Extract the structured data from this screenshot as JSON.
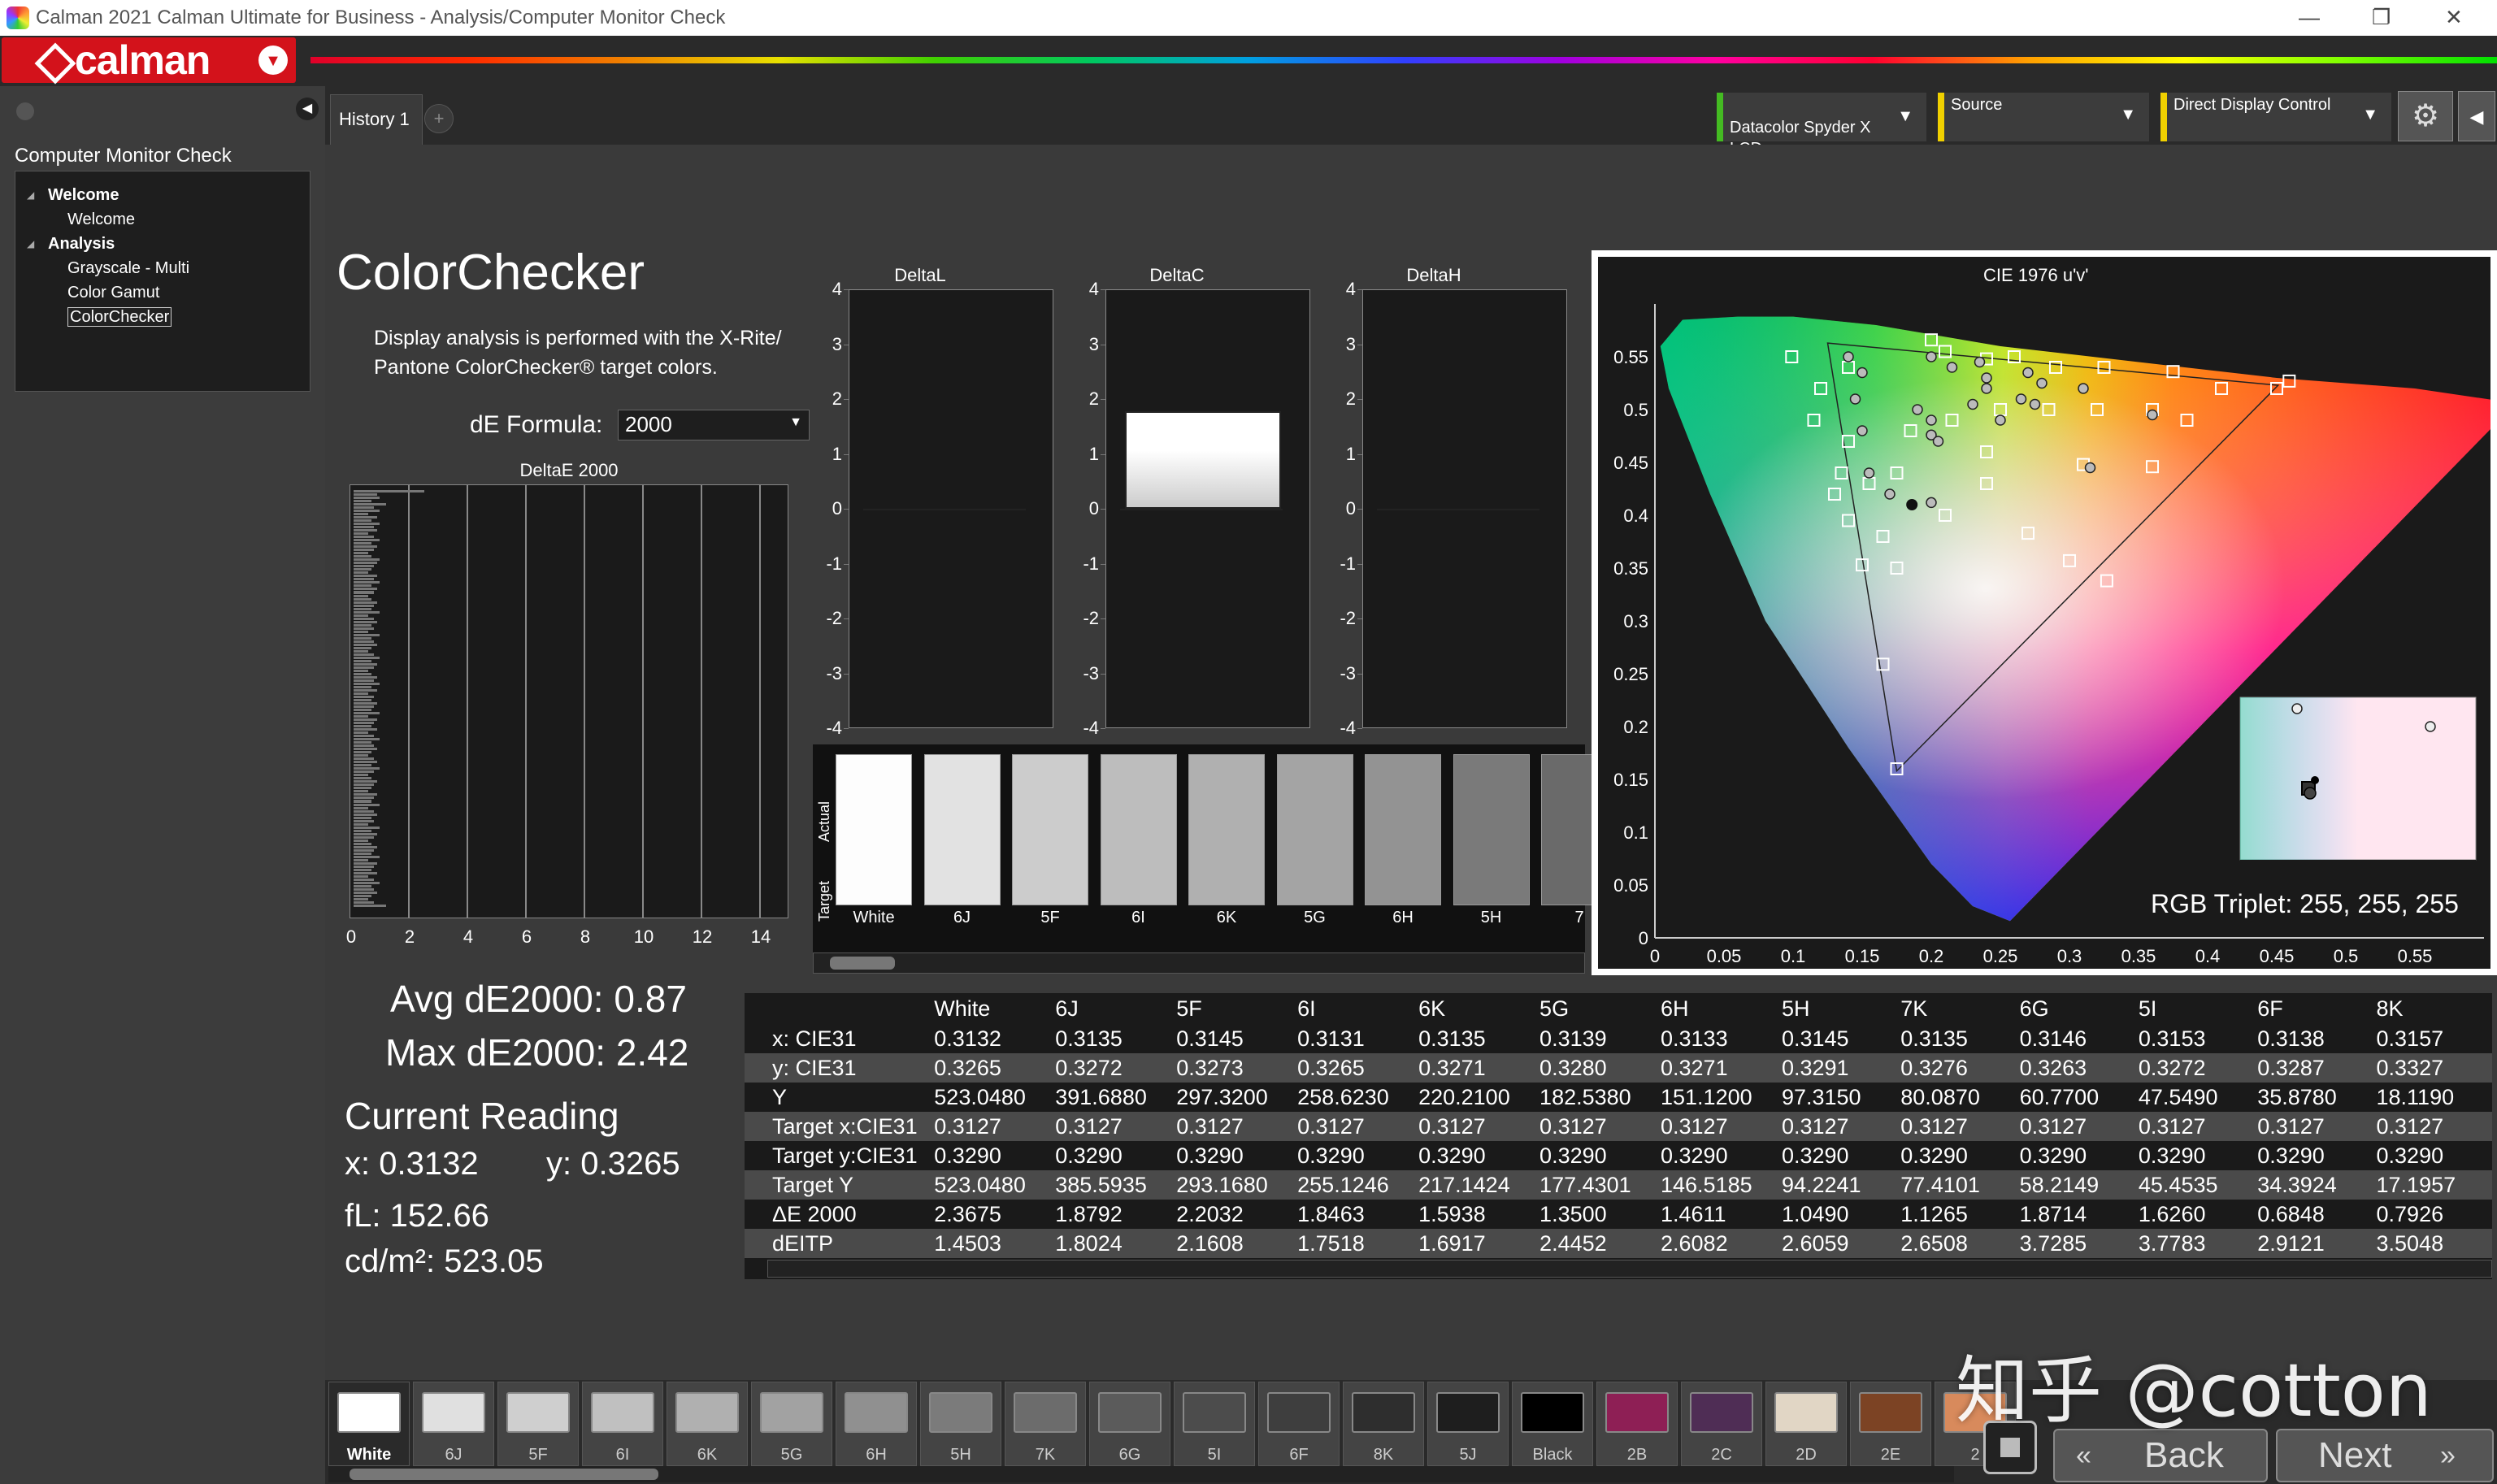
{
  "window": {
    "title": "Calman 2021 Calman Ultimate for Business  - Analysis/Computer Monitor Check"
  },
  "logo": {
    "text": "calman"
  },
  "sidebar": {
    "workflow_title": "Computer Monitor Check",
    "tree": [
      {
        "label": "Welcome",
        "level": 1
      },
      {
        "label": "Welcome",
        "level": 2
      },
      {
        "label": "Analysis",
        "level": 1
      },
      {
        "label": "Grayscale - Multi",
        "level": 2
      },
      {
        "label": "Color Gamut",
        "level": 2
      },
      {
        "label": "ColorChecker",
        "level": 2,
        "selected": true
      }
    ]
  },
  "tabs": {
    "history_label": "History 1",
    "add_label": "+"
  },
  "devices": {
    "meter": "Datacolor Spyder X\nLCD",
    "source": "Source",
    "display": "Direct Display Control",
    "meter_color": "#44bb22",
    "source_color": "#f0d000",
    "display_color": "#f0d000"
  },
  "page": {
    "title": "ColorChecker",
    "description": "Display analysis is performed with the X-Rite/ Pantone ColorChecker® target colors.",
    "de_formula_label": "dE Formula:",
    "de_formula_value": "2000"
  },
  "histogram": {
    "title": "DeltaE 2000",
    "x_ticks": [
      "0",
      "2",
      "4",
      "6",
      "8",
      "10",
      "12",
      "14"
    ],
    "bars": [
      2.42,
      0.8,
      0.9,
      0.6,
      1.1,
      0.7,
      0.9,
      0.5,
      0.8,
      0.6,
      0.9,
      0.7,
      0.8,
      0.5,
      0.7,
      0.9,
      0.6,
      0.8,
      0.7,
      0.5,
      0.6,
      0.9,
      0.8,
      0.7,
      0.6,
      0.5,
      0.8,
      0.7,
      0.9,
      0.6,
      0.8,
      0.7,
      0.5,
      0.6,
      0.8,
      0.7,
      0.6,
      0.9,
      0.5,
      0.7,
      0.8,
      0.6,
      0.7,
      0.5,
      0.9,
      0.6,
      0.7,
      0.8,
      0.6,
      0.5,
      0.7,
      0.9,
      0.6,
      0.8,
      0.7,
      0.5,
      0.6,
      0.8,
      0.7,
      0.9,
      0.6,
      0.8,
      0.5,
      0.7,
      0.6,
      0.8,
      0.7,
      0.6,
      0.9,
      0.5,
      0.8,
      0.7,
      0.6,
      0.8,
      0.5,
      0.7,
      0.9,
      0.6,
      0.7,
      0.8,
      0.6,
      0.5,
      0.7,
      0.8,
      0.6,
      0.9,
      0.7,
      0.5,
      0.6,
      0.8,
      0.7,
      0.6,
      0.5,
      0.8,
      0.7,
      0.6,
      0.9,
      0.5,
      0.7,
      0.8,
      0.6,
      0.7,
      0.5,
      0.9,
      0.6,
      0.8,
      0.7,
      0.5,
      0.6,
      0.8,
      0.7,
      0.6,
      0.9,
      0.5,
      0.8,
      0.7,
      0.6,
      0.8,
      0.5,
      0.7,
      0.9,
      0.6,
      0.7,
      0.8,
      0.6,
      0.5,
      0.7,
      1.1
    ]
  },
  "delta_panels": [
    {
      "title": "DeltaL",
      "value": 0.0
    },
    {
      "title": "DeltaC",
      "value": 1.78
    },
    {
      "title": "DeltaH",
      "value": 0.0
    }
  ],
  "delta_ticks": [
    "4",
    "3",
    "2",
    "1",
    "0",
    "-1",
    "-2",
    "-3",
    "-4"
  ],
  "patch_strip": {
    "actual_label": "Actual",
    "target_label": "Target",
    "patches": [
      {
        "label": "White",
        "color": "#fdfdfd"
      },
      {
        "label": "6J",
        "color": "#e2e2e2"
      },
      {
        "label": "5F",
        "color": "#cccccc"
      },
      {
        "label": "6I",
        "color": "#bdbdbd"
      },
      {
        "label": "6K",
        "color": "#b0b0b0"
      },
      {
        "label": "5G",
        "color": "#a4a4a4"
      },
      {
        "label": "6H",
        "color": "#939393"
      },
      {
        "label": "5H",
        "color": "#7a7a7a"
      },
      {
        "label": "7",
        "color": "#6a6a6a"
      }
    ]
  },
  "cie": {
    "title": "CIE 1976 u'v'",
    "rgb_triplet": "RGB Triplet: 255, 255, 255",
    "x_ticks": [
      "0",
      "0.05",
      "0.1",
      "0.15",
      "0.2",
      "0.25",
      "0.3",
      "0.35",
      "0.4",
      "0.45",
      "0.5",
      "0.55"
    ],
    "y_ticks": [
      "0",
      "0.05",
      "0.1",
      "0.15",
      "0.2",
      "0.25",
      "0.3",
      "0.35",
      "0.4",
      "0.45",
      "0.5",
      "0.55"
    ]
  },
  "stats": {
    "avg": "Avg dE2000: 0.87",
    "max": "Max dE2000: 2.42",
    "current_reading": "Current Reading",
    "x": "x: 0.3132",
    "y": "y: 0.3265",
    "fl": "fL: 152.66",
    "cdm2": "cd/m²: 523.05"
  },
  "table": {
    "columns": [
      "White",
      "6J",
      "5F",
      "6I",
      "6K",
      "5G",
      "6H",
      "5H",
      "7K",
      "6G",
      "5I",
      "6F",
      "8K"
    ],
    "rows": [
      {
        "label": "x: CIE31",
        "values": [
          "0.3132",
          "0.3135",
          "0.3145",
          "0.3131",
          "0.3135",
          "0.3139",
          "0.3133",
          "0.3145",
          "0.3135",
          "0.3146",
          "0.3153",
          "0.3138",
          "0.3157"
        ]
      },
      {
        "label": "y: CIE31",
        "values": [
          "0.3265",
          "0.3272",
          "0.3273",
          "0.3265",
          "0.3271",
          "0.3280",
          "0.3271",
          "0.3291",
          "0.3276",
          "0.3263",
          "0.3272",
          "0.3287",
          "0.3327"
        ]
      },
      {
        "label": "Y",
        "values": [
          "523.0480",
          "391.6880",
          "297.3200",
          "258.6230",
          "220.2100",
          "182.5380",
          "151.1200",
          "97.3150",
          "80.0870",
          "60.7700",
          "47.5490",
          "35.8780",
          "18.1190"
        ]
      },
      {
        "label": "Target x:CIE31",
        "values": [
          "0.3127",
          "0.3127",
          "0.3127",
          "0.3127",
          "0.3127",
          "0.3127",
          "0.3127",
          "0.3127",
          "0.3127",
          "0.3127",
          "0.3127",
          "0.3127",
          "0.3127"
        ]
      },
      {
        "label": "Target y:CIE31",
        "values": [
          "0.3290",
          "0.3290",
          "0.3290",
          "0.3290",
          "0.3290",
          "0.3290",
          "0.3290",
          "0.3290",
          "0.3290",
          "0.3290",
          "0.3290",
          "0.3290",
          "0.3290"
        ]
      },
      {
        "label": "Target Y",
        "values": [
          "523.0480",
          "385.5935",
          "293.1680",
          "255.1246",
          "217.1424",
          "177.4301",
          "146.5185",
          "94.2241",
          "77.4101",
          "58.2149",
          "45.4535",
          "34.3924",
          "17.1957"
        ]
      },
      {
        "label": "ΔE 2000",
        "values": [
          "2.3675",
          "1.8792",
          "2.2032",
          "1.8463",
          "1.5938",
          "1.3500",
          "1.4611",
          "1.0490",
          "1.1265",
          "1.8714",
          "1.6260",
          "0.6848",
          "0.7926"
        ]
      },
      {
        "label": "dEITP",
        "values": [
          "1.4503",
          "1.8024",
          "2.1608",
          "1.7518",
          "1.6917",
          "2.4452",
          "2.6082",
          "2.6059",
          "2.6508",
          "3.7285",
          "3.7783",
          "2.9121",
          "3.5048"
        ]
      }
    ]
  },
  "bottom_strip": [
    {
      "label": "White",
      "color": "#ffffff"
    },
    {
      "label": "6J",
      "color": "#e0e0e0"
    },
    {
      "label": "5F",
      "color": "#cfcfcf"
    },
    {
      "label": "6I",
      "color": "#c0c0c0"
    },
    {
      "label": "6K",
      "color": "#b0b0b0"
    },
    {
      "label": "5G",
      "color": "#a2a2a2"
    },
    {
      "label": "6H",
      "color": "#909090"
    },
    {
      "label": "5H",
      "color": "#7b7b7b"
    },
    {
      "label": "7K",
      "color": "#6c6c6c"
    },
    {
      "label": "6G",
      "color": "#5b5b5b"
    },
    {
      "label": "5I",
      "color": "#4c4c4c"
    },
    {
      "label": "6F",
      "color": "#3e3e3e"
    },
    {
      "label": "8K",
      "color": "#2e2e2e"
    },
    {
      "label": "5J",
      "color": "#1e1e1e"
    },
    {
      "label": "Black",
      "color": "#000000"
    },
    {
      "label": "2B",
      "color": "#8e1f55"
    },
    {
      "label": "2C",
      "color": "#4f2d55"
    },
    {
      "label": "2D",
      "color": "#e1d6c5"
    },
    {
      "label": "2E",
      "color": "#7c4324"
    },
    {
      "label": "2",
      "color": "#d88a5c"
    }
  ],
  "nav": {
    "back": "Back",
    "next": "Next"
  },
  "watermark": "知乎 @cotton"
}
